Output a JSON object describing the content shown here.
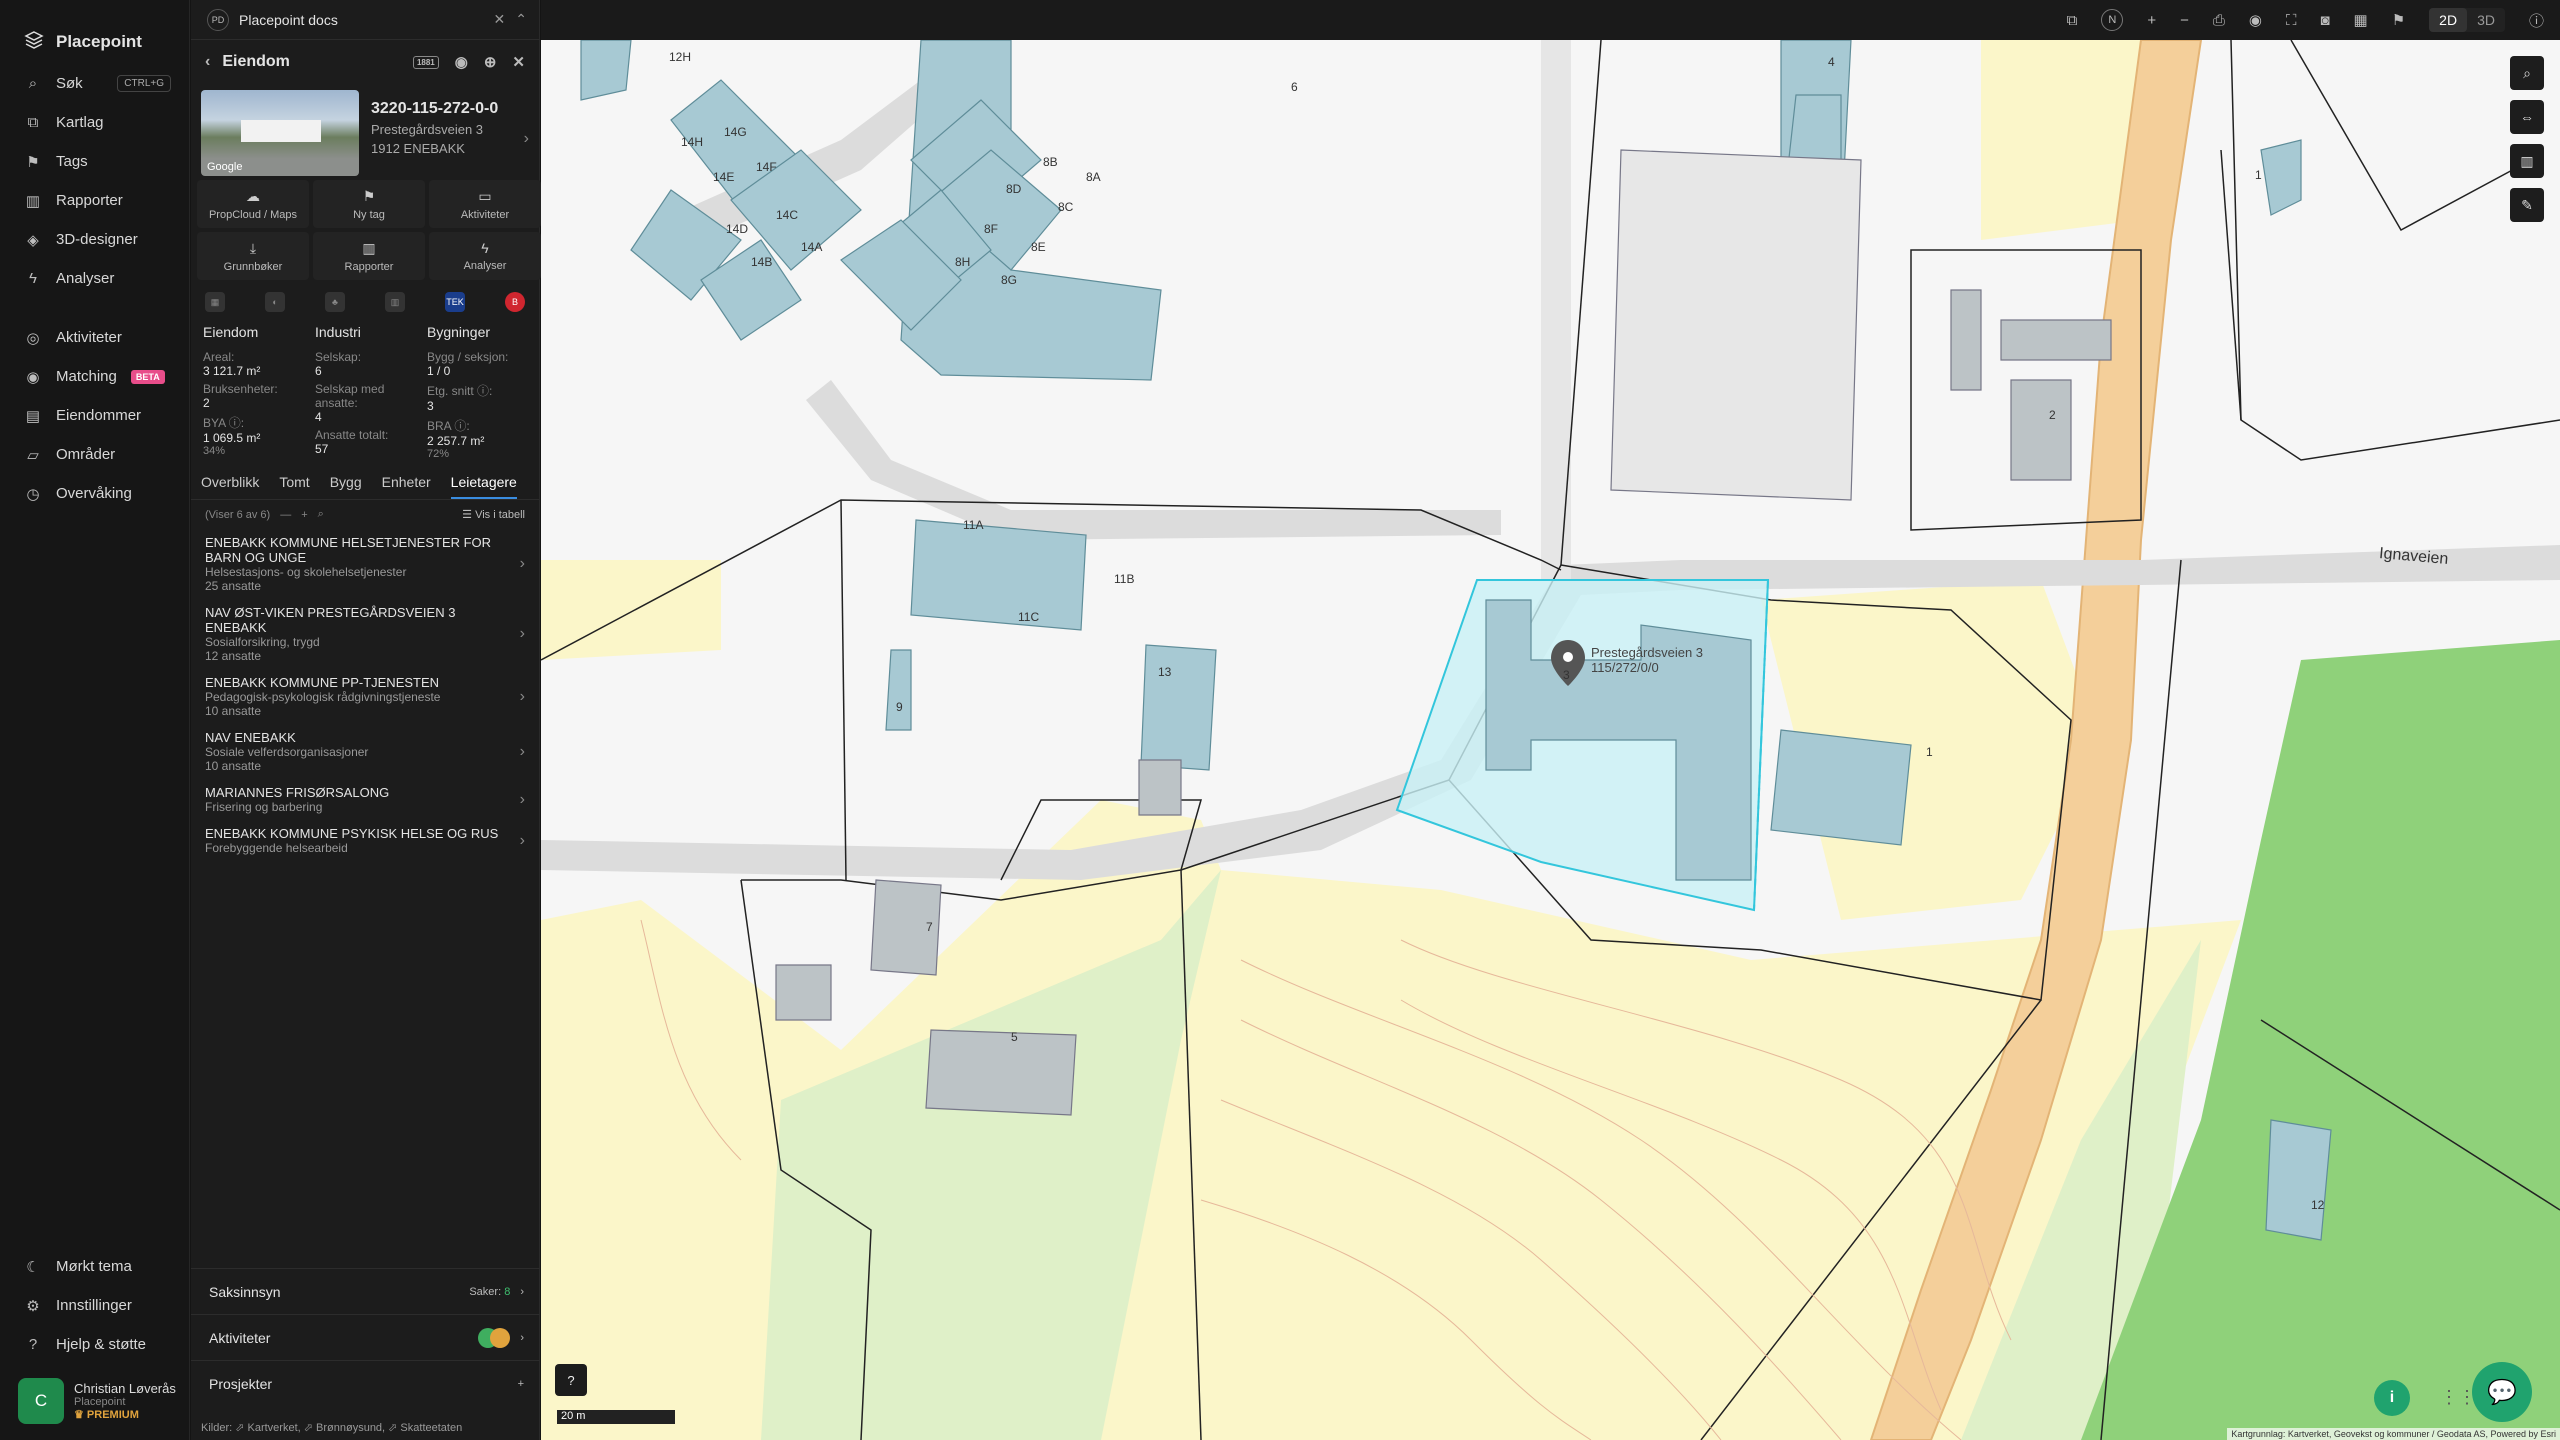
{
  "nav": {
    "brand": "Placepoint",
    "items": [
      {
        "label": "Søk",
        "icon": "search-icon",
        "shortcut": "CTRL+G"
      },
      {
        "label": "Kartlag",
        "icon": "layers-icon"
      },
      {
        "label": "Tags",
        "icon": "bookmark-icon"
      },
      {
        "label": "Rapporter",
        "icon": "chart-icon"
      },
      {
        "label": "3D-designer",
        "icon": "cube-icon"
      },
      {
        "label": "Analyser",
        "icon": "bolt-icon"
      }
    ],
    "items2": [
      {
        "label": "Aktiviteter",
        "icon": "activity-icon"
      },
      {
        "label": "Matching",
        "icon": "target-icon",
        "badge": "BETA"
      },
      {
        "label": "Eiendommer",
        "icon": "building-icon"
      },
      {
        "label": "Områder",
        "icon": "area-icon"
      },
      {
        "label": "Overvåking",
        "icon": "monitor-icon"
      }
    ],
    "bottom": [
      {
        "label": "Mørkt tema",
        "icon": "moon-icon"
      },
      {
        "label": "Innstillinger",
        "icon": "gear-icon"
      },
      {
        "label": "Hjelp & støtte",
        "icon": "help-icon"
      }
    ],
    "user": {
      "initial": "C",
      "name": "Christian Løverås",
      "org": "Placepoint",
      "plan": "PREMIUM"
    }
  },
  "panel": {
    "tab_badge": "PD",
    "tab_title": "Placepoint docs",
    "header_title": "Eiendom",
    "header_badge": "1881",
    "property_id": "3220-115-272-0-0",
    "address_line1": "Prestegårdsveien 3",
    "address_line2": "1912 ENEBAKK",
    "thumb_label": "Google",
    "actions": [
      {
        "label": "PropCloud / Maps",
        "icon": "cloud-icon"
      },
      {
        "label": "Ny tag",
        "icon": "tag-icon"
      },
      {
        "label": "Aktiviteter",
        "icon": "chat-icon"
      },
      {
        "label": "Grunnbøker",
        "icon": "download-icon"
      },
      {
        "label": "Rapporter",
        "icon": "chart-icon"
      },
      {
        "label": "Analyser",
        "icon": "bolt-icon"
      }
    ],
    "sources": {
      "tek": "TEK",
      "b": "B"
    },
    "stats": {
      "eiendom": {
        "title": "Eiendom",
        "areal_k": "Areal:",
        "areal_v": "3 121.7 m²",
        "bruks_k": "Bruksenheter:",
        "bruks_v": "2",
        "bya_k": "BYA ⓘ:",
        "bya_v": "1 069.5 m²",
        "bya_p": "34%"
      },
      "industri": {
        "title": "Industri",
        "selskap_k": "Selskap:",
        "selskap_v": "6",
        "med_k": "Selskap med ansatte:",
        "med_v": "4",
        "ansatte_k": "Ansatte totalt:",
        "ansatte_v": "57"
      },
      "bygninger": {
        "title": "Bygninger",
        "bygg_k": "Bygg / seksjon:",
        "bygg_v": "1 / 0",
        "etg_k": "Etg. snitt ⓘ:",
        "etg_v": "3",
        "bra_k": "BRA ⓘ:",
        "bra_v": "2 257.7 m²",
        "bra_p": "72%"
      }
    },
    "subtabs": [
      "Overblikk",
      "Tomt",
      "Bygg",
      "Enheter",
      "Leietagere"
    ],
    "active_subtab": "Leietagere",
    "list_count": "(Viser 6 av 6)",
    "list_table": "Vis i tabell",
    "tenants": [
      {
        "name": "ENEBAKK KOMMUNE HELSETJENESTER FOR BARN OG UNGE",
        "cat": "Helsestasjons- og skolehelsetjenester",
        "emp": "25 ansatte"
      },
      {
        "name": "NAV ØST-VIKEN PRESTEGÅRDSVEIEN 3 ENEBAKK",
        "cat": "Sosialforsikring, trygd",
        "emp": "12 ansatte"
      },
      {
        "name": "ENEBAKK KOMMUNE PP-TJENESTEN",
        "cat": "Pedagogisk-psykologisk rådgivningstjeneste",
        "emp": "10 ansatte"
      },
      {
        "name": "NAV ENEBAKK",
        "cat": "Sosiale velferdsorganisasjoner",
        "emp": "10 ansatte"
      },
      {
        "name": "MARIANNES FRISØRSALONG",
        "cat": "Frisering og barbering",
        "emp": ""
      },
      {
        "name": "ENEBAKK KOMMUNE PSYKISK HELSE OG RUS",
        "cat": "Forebyggende helsearbeid",
        "emp": ""
      }
    ],
    "sections": {
      "saksinnsyn": "Saksinnsyn",
      "saker_label": "Saker:",
      "saker_count": "8",
      "aktiviteter": "Aktiviteter",
      "prosjekter": "Prosjekter"
    },
    "footer": "Kilder: ⬀ Kartverket, ⬀ Brønnøysund, ⬀ Skatteetaten"
  },
  "topbar": {
    "compass": "N",
    "mode_2d": "2D",
    "mode_3d": "3D"
  },
  "map": {
    "road_name": "Ignaveien",
    "selected_label_line1": "Prestegårdsveien 3",
    "selected_label_line2": "115/272/0/0",
    "selected_number": "3",
    "scale": "20 m",
    "attribution": "Kartgrunnlag: Kartverket, Geovekst og kommuner / Geodata AS, Powered by Esri",
    "building_labels": [
      "12H",
      "14G",
      "14H",
      "14F",
      "14E",
      "14C",
      "14D",
      "14B",
      "14A",
      "8B",
      "8A",
      "8D",
      "8C",
      "8F",
      "8E",
      "8H",
      "8G",
      "6",
      "4",
      "11A",
      "11B",
      "11C",
      "13",
      "9",
      "7",
      "5",
      "1",
      "2",
      "1",
      "12"
    ]
  }
}
